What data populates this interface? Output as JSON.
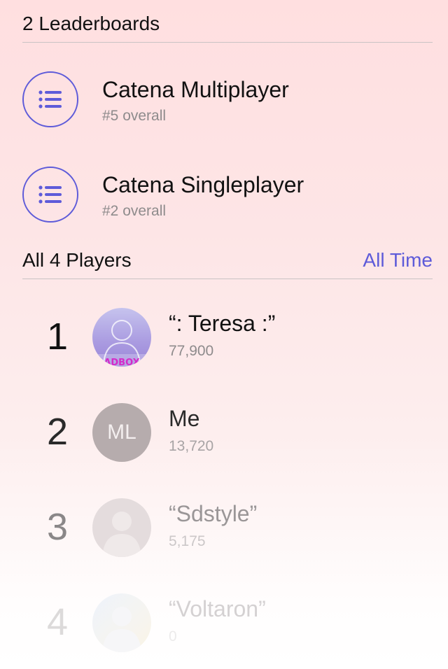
{
  "leaderboards_header": "2 Leaderboards",
  "leaderboards": [
    {
      "title": "Catena Multiplayer",
      "subtitle": "#5 overall",
      "icon": "list-icon"
    },
    {
      "title": "Catena Singleplayer",
      "subtitle": "#2 overall",
      "icon": "list-icon"
    }
  ],
  "players_header": {
    "label": "All 4 Players",
    "filter": "All Time"
  },
  "players": [
    {
      "rank": "1",
      "name": "“: Teresa :”",
      "score": "77,900",
      "avatar": "photo-avatar",
      "avatar_text": "ADBOX"
    },
    {
      "rank": "2",
      "name": "Me",
      "score": "13,720",
      "avatar": "initials-avatar",
      "initials": "ML"
    },
    {
      "rank": "3",
      "name": "“Sdstyle”",
      "score": "5,175",
      "avatar": "silhouette-avatar"
    },
    {
      "rank": "4",
      "name": "“Voltaron”",
      "score": "0",
      "avatar": "silhouette-avatar"
    }
  ],
  "colors": {
    "accent": "#5e5bd9",
    "divider": "#c9c3c4",
    "secondary_text": "#8e8b8c"
  }
}
